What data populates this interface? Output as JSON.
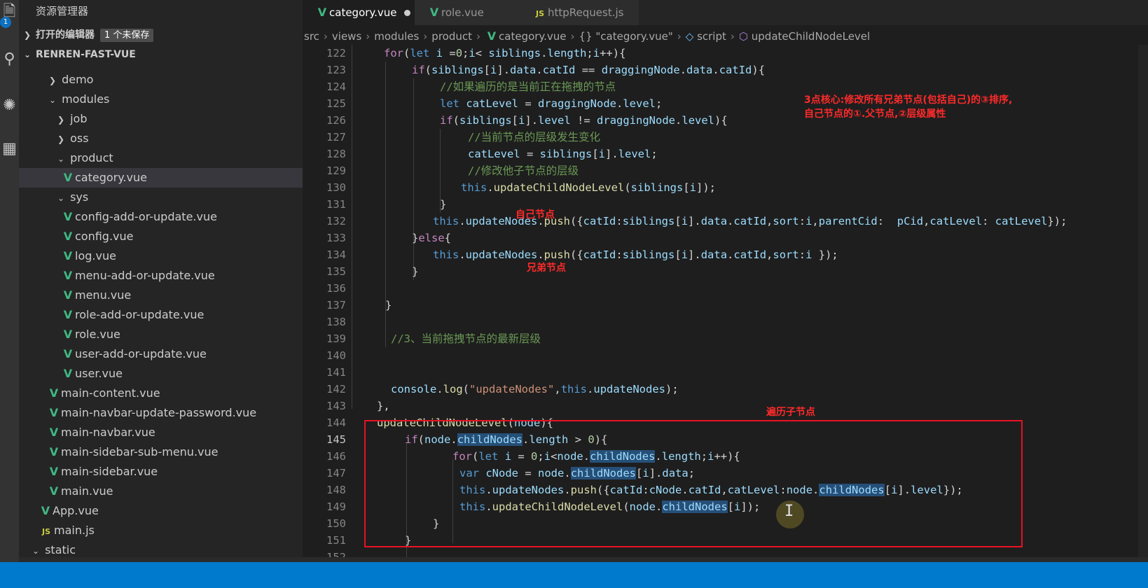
{
  "activity_bar": {
    "explorer_badge": "1",
    "icons": [
      "files-icon",
      "search-icon",
      "debug-icon",
      "extensions-icon"
    ]
  },
  "sidebar": {
    "title": "资源管理器",
    "open_editors": {
      "label": "打开的编辑器",
      "badge": "1 个未保存"
    },
    "project": {
      "label": "RENREN-FAST-VUE"
    },
    "tree": [
      {
        "label": "demo",
        "kind": "folder",
        "open": false
      },
      {
        "label": "modules",
        "kind": "folder",
        "open": true
      },
      {
        "label": "job",
        "kind": "folder",
        "open": false
      },
      {
        "label": "oss",
        "kind": "folder",
        "open": false
      },
      {
        "label": "product",
        "kind": "folder",
        "open": true
      },
      {
        "label": "category.vue",
        "kind": "vue",
        "active": true
      },
      {
        "label": "sys",
        "kind": "folder",
        "open": true
      },
      {
        "label": "config-add-or-update.vue",
        "kind": "vue"
      },
      {
        "label": "config.vue",
        "kind": "vue"
      },
      {
        "label": "log.vue",
        "kind": "vue"
      },
      {
        "label": "menu-add-or-update.vue",
        "kind": "vue"
      },
      {
        "label": "menu.vue",
        "kind": "vue"
      },
      {
        "label": "role-add-or-update.vue",
        "kind": "vue"
      },
      {
        "label": "role.vue",
        "kind": "vue"
      },
      {
        "label": "user-add-or-update.vue",
        "kind": "vue"
      },
      {
        "label": "user.vue",
        "kind": "vue"
      },
      {
        "label": "main-content.vue",
        "kind": "vue"
      },
      {
        "label": "main-navbar-update-password.vue",
        "kind": "vue"
      },
      {
        "label": "main-navbar.vue",
        "kind": "vue"
      },
      {
        "label": "main-sidebar-sub-menu.vue",
        "kind": "vue"
      },
      {
        "label": "main-sidebar.vue",
        "kind": "vue"
      },
      {
        "label": "main.vue",
        "kind": "vue"
      },
      {
        "label": "App.vue",
        "kind": "vue"
      },
      {
        "label": "main.js",
        "kind": "js"
      },
      {
        "label": "static",
        "kind": "folder",
        "open": true
      }
    ]
  },
  "tabs": [
    {
      "label": "category.vue",
      "active": true,
      "dirty": true
    },
    {
      "label": "role.vue",
      "active": false
    },
    {
      "label": "httpRequest.js",
      "active": false
    }
  ],
  "breadcrumb": [
    "src",
    "views",
    "modules",
    "product",
    "category.vue",
    "{} \"category.vue\"",
    "script",
    "updateChildNodeLevel"
  ],
  "code": {
    "current_line": 145,
    "lines": [
      {
        "n": "122"
      },
      {
        "n": "123"
      },
      {
        "n": "124"
      },
      {
        "n": "125"
      },
      {
        "n": "126"
      },
      {
        "n": "127"
      },
      {
        "n": "128"
      },
      {
        "n": "129"
      },
      {
        "n": "130"
      },
      {
        "n": "131"
      },
      {
        "n": "132"
      },
      {
        "n": "133"
      },
      {
        "n": "134"
      },
      {
        "n": "135"
      },
      {
        "n": "136"
      },
      {
        "n": "137"
      },
      {
        "n": "138"
      },
      {
        "n": "139"
      },
      {
        "n": "140"
      },
      {
        "n": "141"
      },
      {
        "n": "142"
      },
      {
        "n": "143"
      },
      {
        "n": "144"
      },
      {
        "n": "145"
      },
      {
        "n": "146"
      },
      {
        "n": "147"
      },
      {
        "n": "148"
      },
      {
        "n": "149"
      },
      {
        "n": "150"
      },
      {
        "n": "151"
      },
      {
        "n": "152"
      }
    ],
    "comments": {
      "c124": "//如果遍历的是当前正在拖拽的节点",
      "c127": "//当前节点的层级发生变化",
      "c129": "//修改他子节点的层级",
      "c139": "//3、当前拖拽节点的最新层级"
    },
    "strings": {
      "s142": "\"updateNodes\""
    }
  },
  "annotations": {
    "core_line1": "3点核心:修改所有兄弟节点(包括自己)的③排序,",
    "core_line2": "自己节点的①.父节点,②层级属性",
    "self_node": "自己节点",
    "sibling_node": "兄弟节点",
    "traverse_children": "遍历子节点"
  },
  "colors": {
    "accent": "#007acc",
    "annotation_red": "#ff2a2a",
    "vue_green": "#41b883"
  }
}
